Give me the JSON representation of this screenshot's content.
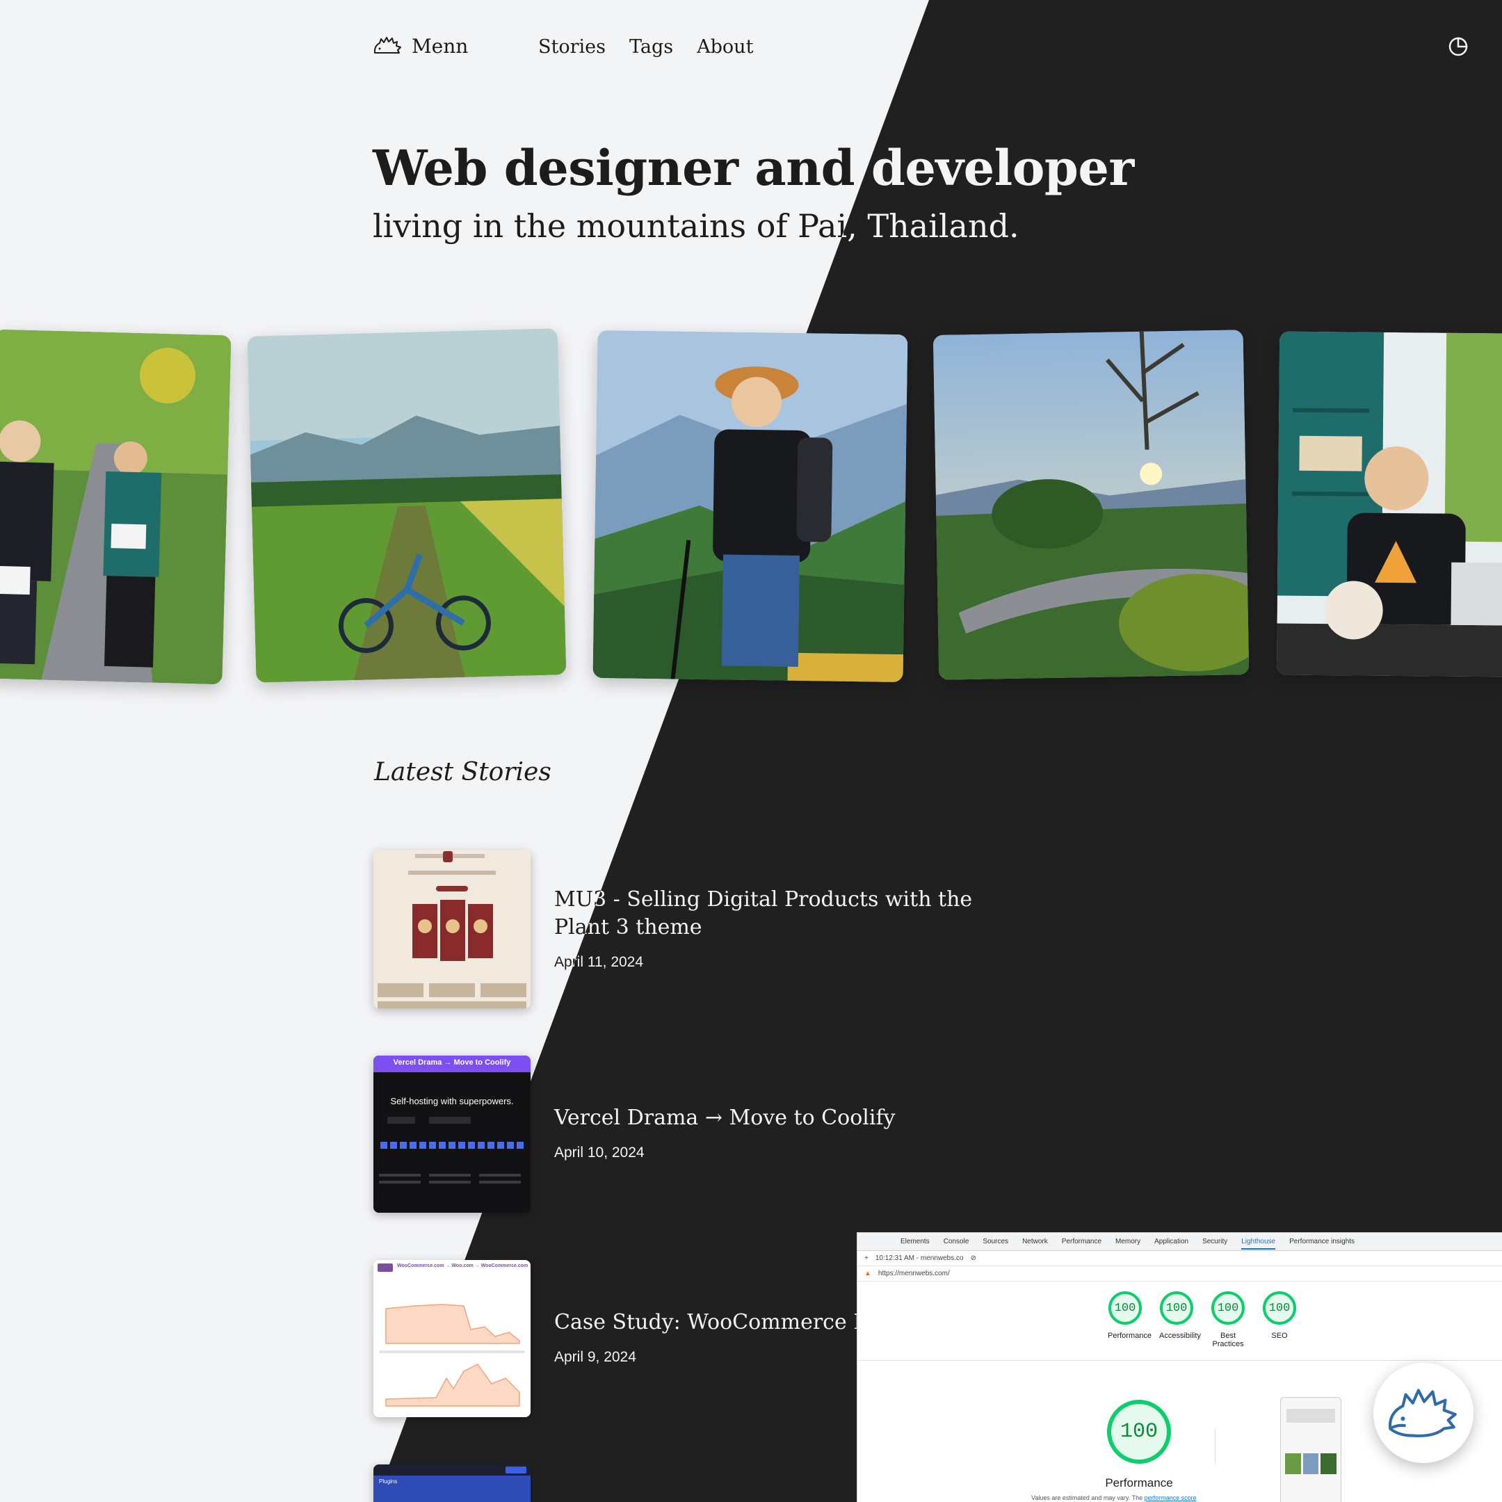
{
  "brand": {
    "name": "Menn"
  },
  "nav": [
    "Stories",
    "Tags",
    "About"
  ],
  "hero": {
    "title": "Web designer and developer",
    "subtitle": "living in the mountains of Pai, Thailand."
  },
  "latest": {
    "heading": "Latest Stories",
    "stories": [
      {
        "title": "MU3 - Selling Digital Products with the Plant 3 theme",
        "date": "April 11, 2024"
      },
      {
        "title": "Vercel Drama → Move to Coolify",
        "date": "April 10, 2024"
      },
      {
        "title": "Case Study: WooCommerce Dom",
        "date": "April 9, 2024"
      }
    ]
  },
  "thumbs": {
    "vercel": {
      "banner": "Vercel Drama → Move to Coolify",
      "headline": "Self-hosting with superpowers."
    },
    "woo": {
      "banner": "WooCommerce.com → Woo.com → WooCommerce.com"
    },
    "plugins": {
      "label": "Plugins"
    }
  },
  "lighthouse": {
    "tabs": [
      "Elements",
      "Console",
      "Sources",
      "Network",
      "Performance",
      "Memory",
      "Application",
      "Security",
      "Lighthouse",
      "Performance insights"
    ],
    "active_tab": "Lighthouse",
    "time": "10:12:31 AM - mennwebs.co",
    "url": "https://mennwebs.com/",
    "scores": [
      {
        "label": "Performance",
        "value": "100"
      },
      {
        "label": "Accessibility",
        "value": "100"
      },
      {
        "label": "Best Practices",
        "value": "100"
      },
      {
        "label": "SEO",
        "value": "100"
      }
    ],
    "main_score": {
      "label": "Performance",
      "value": "100"
    },
    "note": "Values are estimated and may vary. The",
    "note_link": "performance score"
  },
  "colors": {
    "light_bg": "#f3f4f6",
    "dark_bg": "#202020",
    "score_green": "#0cce6b"
  }
}
